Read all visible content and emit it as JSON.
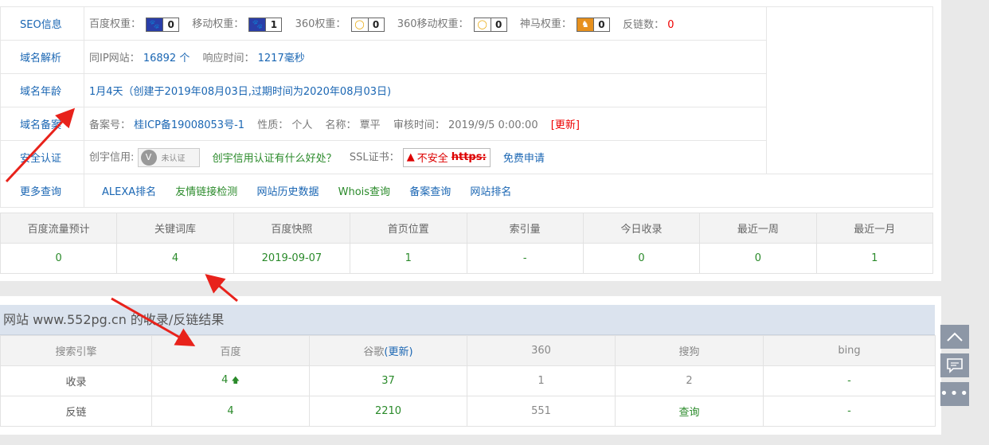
{
  "seo": {
    "label": "SEO信息",
    "items": [
      {
        "label": "百度权重：",
        "value": "0",
        "icon": "paw"
      },
      {
        "label": "移动权重：",
        "value": "1",
        "icon": "paw"
      },
      {
        "label": "360权重：",
        "value": "0",
        "icon": "q"
      },
      {
        "label": "360移动权重：",
        "value": "0",
        "icon": "q"
      },
      {
        "label": "神马权重：",
        "value": "0",
        "icon": "sm"
      }
    ],
    "backlinks_label": "反链数：",
    "backlinks_value": "0"
  },
  "resolve": {
    "label": "域名解析",
    "same_ip_label": "同IP网站：",
    "same_ip_value": "16892 个",
    "response_label": "响应时间：",
    "response_value": "1217毫秒"
  },
  "age": {
    "label": "域名年龄",
    "text": "1月4天（创建于2019年08月03日,过期时间为2020年08月03日)"
  },
  "icp": {
    "label": "域名备案",
    "no_label": "备案号：",
    "no_value": "桂ICP备19008053号-1",
    "nature_label": "性质：",
    "nature_value": "个人",
    "name_label": "名称：",
    "name_value": "覃平",
    "audit_label": "审核时间：",
    "audit_value": "2019/9/5 0:00:00",
    "update_label": "[更新]"
  },
  "security": {
    "label": "安全认证",
    "credit_label": "创宇信用:",
    "unauth_label": "未认证",
    "credit_link": "创宇信用认证有什么好处？",
    "ssl_label": "SSL证书：",
    "ssl_badge": "不安全",
    "ssl_scheme": "https:",
    "free_apply": "免费申请"
  },
  "more": {
    "label": "更多查询",
    "links": [
      "ALEXA排名",
      "友情链接检测",
      "网站历史数据",
      "Whois查询",
      "备案查询",
      "网站排名"
    ]
  },
  "stats": {
    "headers": [
      "百度流量预计",
      "关键词库",
      "百度快照",
      "首页位置",
      "索引量",
      "今日收录",
      "最近一周",
      "最近一月"
    ],
    "values": [
      "0",
      "4",
      "2019-09-07",
      "1",
      "-",
      "0",
      "0",
      "1"
    ]
  },
  "results": {
    "title": "网站 www.552pg.cn 的收录/反链结果",
    "headers": [
      "搜索引擎",
      "百度",
      "谷歌",
      "(更新)",
      "360",
      "搜狗",
      "bing"
    ],
    "rows": [
      {
        "label": "收录",
        "cells": [
          "4",
          "37",
          "1",
          "2",
          "-"
        ]
      },
      {
        "label": "反链",
        "cells": [
          "4",
          "2210",
          "551",
          "查询",
          "-"
        ]
      }
    ]
  },
  "colors": {
    "accent_blue": "#1a66b3",
    "value_green": "#2a8a2a",
    "danger_red": "#e00000",
    "annotation_red": "#e8221b"
  }
}
